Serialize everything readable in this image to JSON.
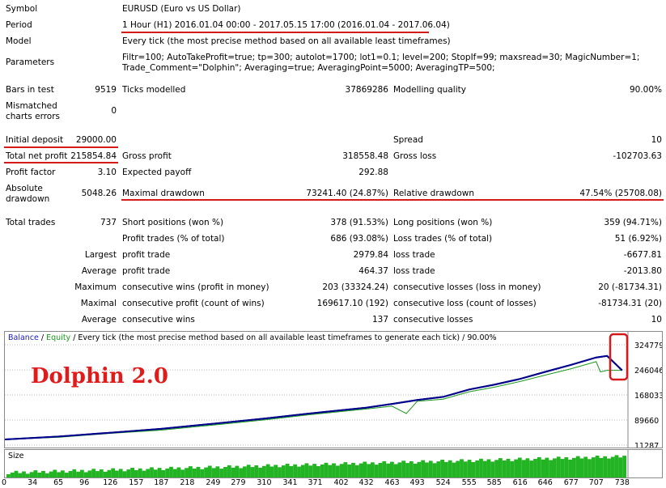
{
  "report": {
    "symbol_label": "Symbol",
    "symbol_value": "EURUSD (Euro vs US Dollar)",
    "period_label": "Period",
    "period_value": "1 Hour (H1) 2016.01.04 00:00 - 2017.05.15 17:00 (2016.01.04 - 2017.06.04)",
    "model_label": "Model",
    "model_value": "Every tick (the most precise method based on all available least timeframes)",
    "params_label": "Parameters",
    "params_line1": "Filtr=100; AutoTakeProfit=true; tp=300; autolot=1700; lot1=0.1; level=200; StopIf=99; maxsread=30; MagicNumber=1;",
    "params_line2": "Trade_Comment=\"Dolphin\"; Averaging=true; AveragingPoint=5000; AveragingTP=500;",
    "bars_label": "Bars in test",
    "bars_value": "9519",
    "ticks_label": "Ticks modelled",
    "ticks_value": "37869286",
    "quality_label": "Modelling quality",
    "quality_value": "90.00%",
    "mismatch_label1": "Mismatched",
    "mismatch_label2": "charts errors",
    "mismatch_value": "0",
    "deposit_label": "Initial deposit",
    "deposit_value": "29000.00",
    "spread_label": "Spread",
    "spread_value": "10",
    "netprofit_label": "Total net profit",
    "netprofit_value": "215854.84",
    "grossprofit_label": "Gross profit",
    "grossprofit_value": "318558.48",
    "grossloss_label": "Gross loss",
    "grossloss_value": "-102703.63",
    "pf_label": "Profit factor",
    "pf_value": "3.10",
    "payoff_label": "Expected payoff",
    "payoff_value": "292.88",
    "absdd_label1": "Absolute",
    "absdd_label2": "drawdown",
    "absdd_value": "5048.26",
    "maxdd_label": "Maximal drawdown",
    "maxdd_value": "73241.40 (24.87%)",
    "reldd_label": "Relative drawdown",
    "reldd_value": "47.54% (25708.08)",
    "trades_label": "Total trades",
    "trades_value": "737",
    "short_label": "Short positions (won %)",
    "short_value": "378 (91.53%)",
    "long_label": "Long positions (won %)",
    "long_value": "359 (94.71%)",
    "ptrades_label": "Profit trades (% of total)",
    "ptrades_value": "686 (93.08%)",
    "ltrades_label": "Loss trades (% of total)",
    "ltrades_value": "51 (6.92%)",
    "largest_label": "Largest",
    "largest_profit_label": "profit trade",
    "largest_profit_value": "2979.84",
    "largest_loss_label": "loss trade",
    "largest_loss_value": "-6677.81",
    "average_label": "Average",
    "average_profit_label": "profit trade",
    "average_profit_value": "464.37",
    "average_loss_label": "loss trade",
    "average_loss_value": "-2013.80",
    "maximum_label": "Maximum",
    "maxwins_label": "consecutive wins (profit in money)",
    "maxwins_value": "203 (33324.24)",
    "maxlosses_label": "consecutive losses (loss in money)",
    "maxlosses_value": "20 (-81734.31)",
    "maximal_label": "Maximal",
    "maxprofit_label": "consecutive profit (count of wins)",
    "maxprofit_value": "169617.10 (192)",
    "maxloss_label": "consecutive loss (count of losses)",
    "maxloss_value": "-81734.31 (20)",
    "avgcons_label": "Average",
    "avgwins_label": "consecutive wins",
    "avgwins_value": "137",
    "avglosses_label": "consecutive losses",
    "avglosses_value": "10"
  },
  "chart": {
    "legend_balance": "Balance",
    "legend_sep": " / ",
    "legend_equity": "Equity",
    "legend_rest": " / Every tick (the most precise method based on all available least timeframes to generate each tick) / 90.00%",
    "overlay_title": "Dolphin 2.0",
    "size_label": "Size",
    "balance_color": "#00008b",
    "equity_color": "#1a9a1a",
    "accent_red": "#d61a1a"
  },
  "chart_data": {
    "type": "line",
    "y_ticks": [
      "324779",
      "246046",
      "168033",
      "89660",
      "11287"
    ],
    "x_ticks": [
      "0",
      "34",
      "65",
      "96",
      "126",
      "157",
      "187",
      "218",
      "249",
      "279",
      "310",
      "341",
      "371",
      "402",
      "432",
      "463",
      "493",
      "524",
      "555",
      "585",
      "616",
      "646",
      "677",
      "707",
      "738"
    ],
    "series": [
      {
        "name": "Balance",
        "x": [
          0,
          65,
          126,
          187,
          249,
          310,
          371,
          432,
          463,
          493,
          524,
          555,
          585,
          616,
          646,
          677,
          707,
          720,
          738
        ],
        "values": [
          29000,
          38000,
          50000,
          62000,
          78000,
          94000,
          112000,
          128000,
          140000,
          152000,
          162000,
          185000,
          200000,
          218000,
          240000,
          262000,
          285000,
          290000,
          245000
        ]
      },
      {
        "name": "Equity",
        "x": [
          0,
          65,
          126,
          187,
          249,
          310,
          371,
          432,
          463,
          480,
          493,
          524,
          555,
          585,
          616,
          646,
          677,
          707,
          712,
          720,
          738
        ],
        "values": [
          29000,
          36000,
          48000,
          58000,
          74000,
          90000,
          108000,
          124000,
          133000,
          110000,
          148000,
          155000,
          178000,
          192000,
          210000,
          230000,
          250000,
          272000,
          240000,
          245000,
          245000
        ]
      }
    ]
  }
}
